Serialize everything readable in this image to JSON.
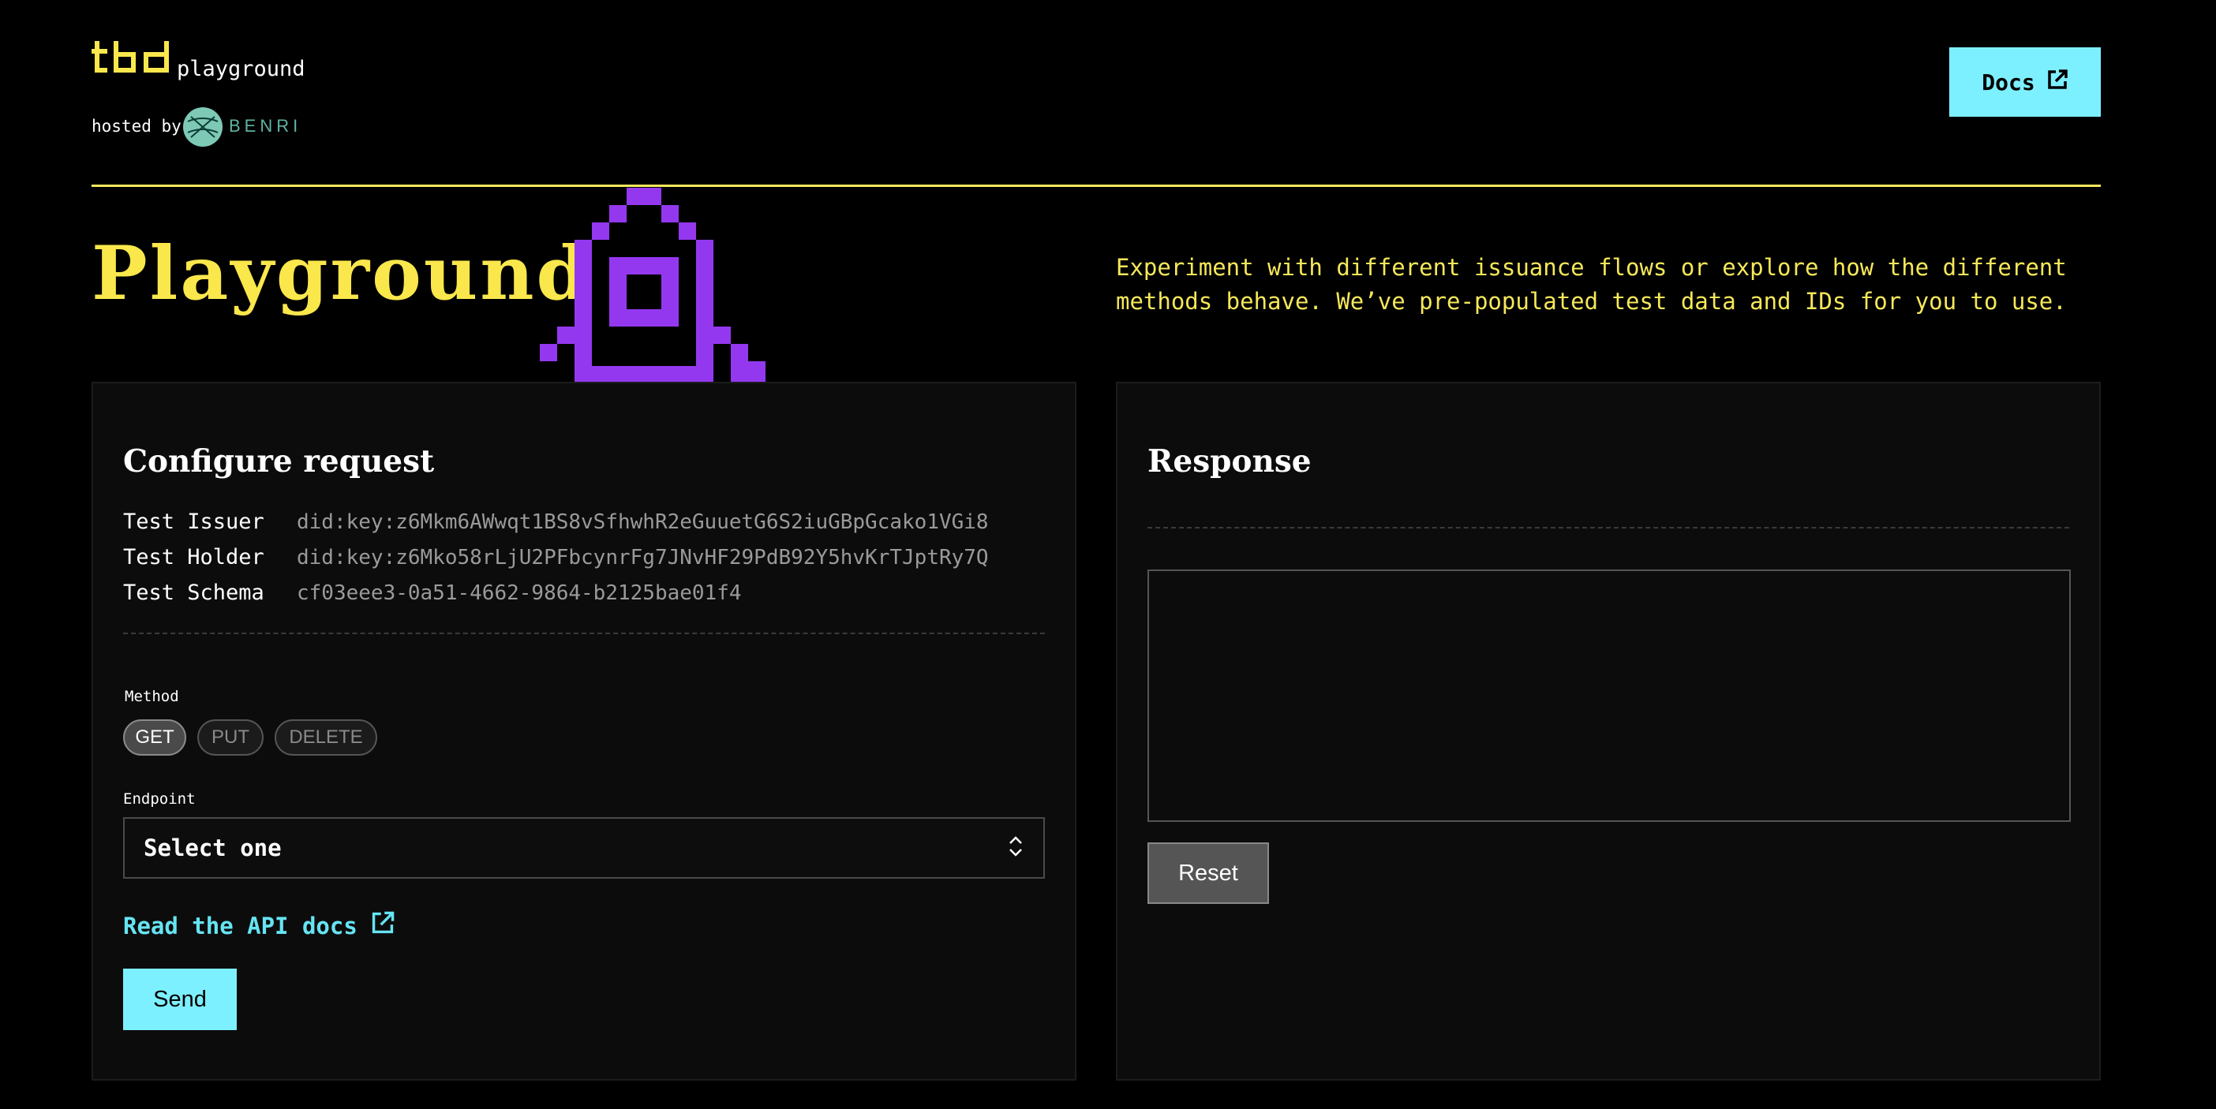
{
  "header": {
    "logo_mark": "tbd",
    "logo_word": "playground",
    "hosted_by": "hosted by",
    "partner_name": "BENRI",
    "docs_label": "Docs"
  },
  "hero": {
    "title": "Playground",
    "description": "Experiment with different issuance flows or explore how the different methods behave. We’ve pre-populated test data and IDs for you to use."
  },
  "request": {
    "title": "Configure request",
    "test_values": [
      {
        "label": "Test Issuer",
        "value": "did:key:z6Mkm6AWwqt1BS8vSfhwhR2eGuuetG6S2iuGBpGcako1VGi8"
      },
      {
        "label": "Test Holder",
        "value": "did:key:z6Mko58rLjU2PFbcynrFg7JNvHF29PdB92Y5hvKrTJptRy7Q"
      },
      {
        "label": "Test Schema",
        "value": "cf03eee3-0a51-4662-9864-b2125bae01f4"
      }
    ],
    "method_label": "Method",
    "methods": [
      "GET",
      "PUT",
      "DELETE"
    ],
    "selected_method": "GET",
    "endpoint_label": "Endpoint",
    "endpoint_value": "Select one",
    "api_docs_link": "Read the API docs",
    "send_label": "Send"
  },
  "response": {
    "title": "Response",
    "body": "",
    "reset_label": "Reset"
  },
  "colors": {
    "accent_yellow": "#f9e74c",
    "accent_cyan": "#7df0ff",
    "rocket_purple": "#9438f0",
    "background": "#000000"
  }
}
